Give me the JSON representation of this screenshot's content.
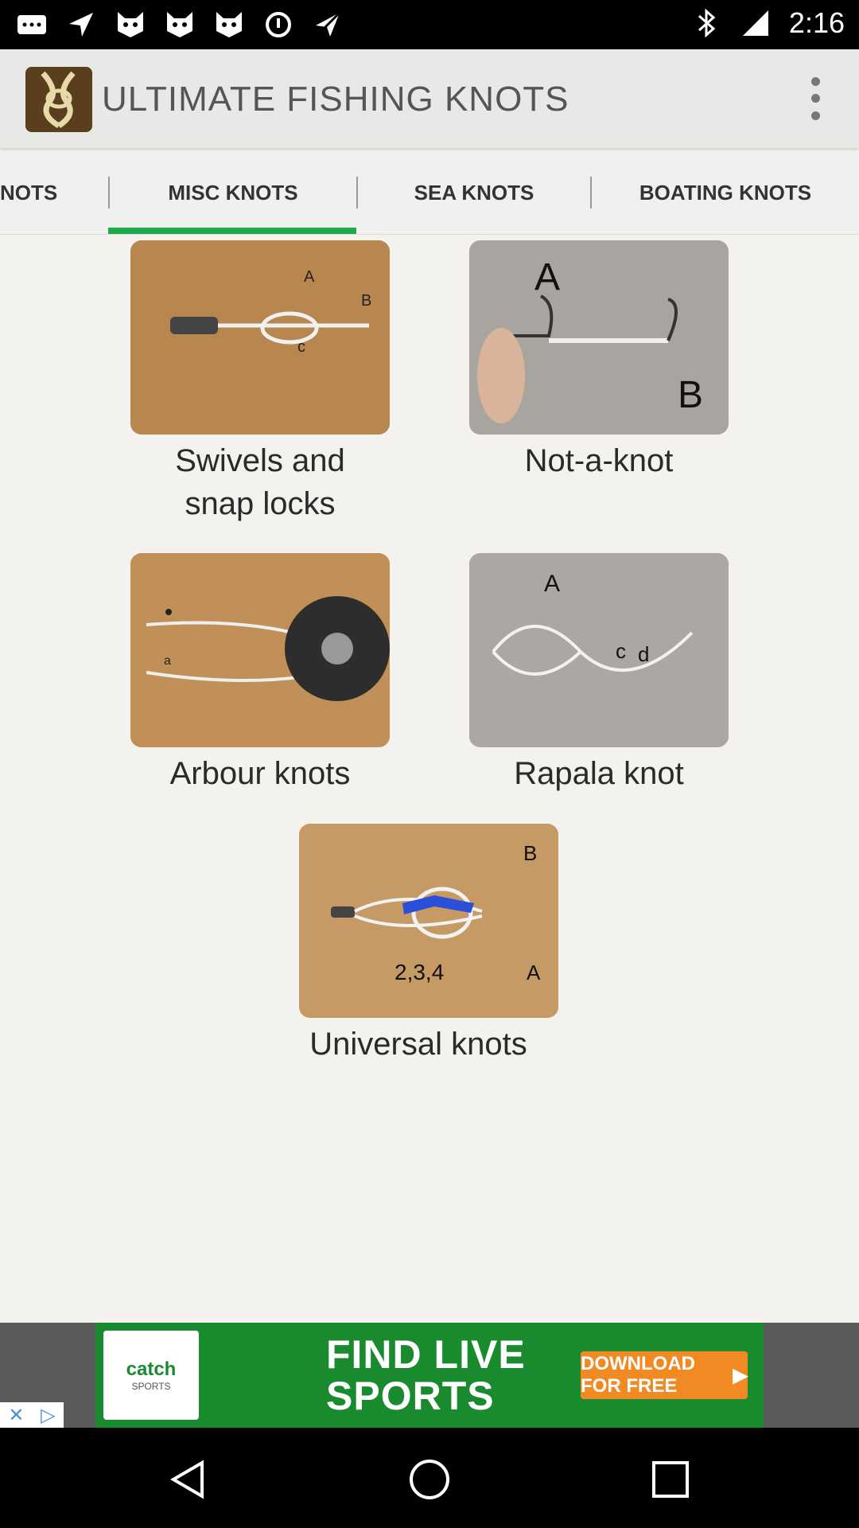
{
  "status_bar": {
    "time": "2:16",
    "left_icons": [
      "messages-icon",
      "navigation-icon",
      "cat-icon",
      "cat-icon",
      "cat-icon",
      "data-saver-icon",
      "fake-gps-icon"
    ],
    "right_icons": [
      "bluetooth-icon",
      "signal-icon"
    ]
  },
  "app_bar": {
    "title": "ULTIMATE FISHING KNOTS"
  },
  "tabs": [
    {
      "label": "NOTS",
      "active": false
    },
    {
      "label": "MISC KNOTS",
      "active": true
    },
    {
      "label": "SEA KNOTS",
      "active": false
    },
    {
      "label": "BOATING KNOTS",
      "active": false
    }
  ],
  "accent_color": "#1fa84c",
  "knots": [
    {
      "label_line1": "Swivels and",
      "label_line2": "snap locks",
      "thumb_letters": "A B C"
    },
    {
      "label_line1": "Not-a-knot",
      "label_line2": "",
      "thumb_letters": "A B"
    },
    {
      "label_line1": "Arbour knots",
      "label_line2": "",
      "thumb_letters": ""
    },
    {
      "label_line1": "Rapala knot",
      "label_line2": "",
      "thumb_letters": "A c d"
    },
    {
      "label_line1": "Universal knots",
      "label_line2": "",
      "thumb_letters": "B 2,3,4 A"
    }
  ],
  "ad": {
    "brand": "catch",
    "brand_sub": "SPORTS",
    "headline_line1": "FIND LIVE",
    "headline_line2": "SPORTS",
    "cta": "DOWNLOAD FOR FREE"
  }
}
